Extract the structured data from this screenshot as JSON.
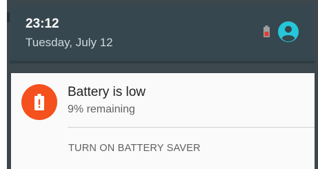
{
  "status": {
    "time": "23:12",
    "date": "Tuesday, July 12",
    "icons": [
      "battery-low-icon",
      "account-icon"
    ],
    "accent_color": "#26c6da"
  },
  "notification": {
    "title": "Battery is low",
    "text": "9% remaining",
    "action_label": "TURN ON BATTERY SAVER",
    "icon": "battery-alert-icon",
    "icon_color": "#f4511e"
  }
}
